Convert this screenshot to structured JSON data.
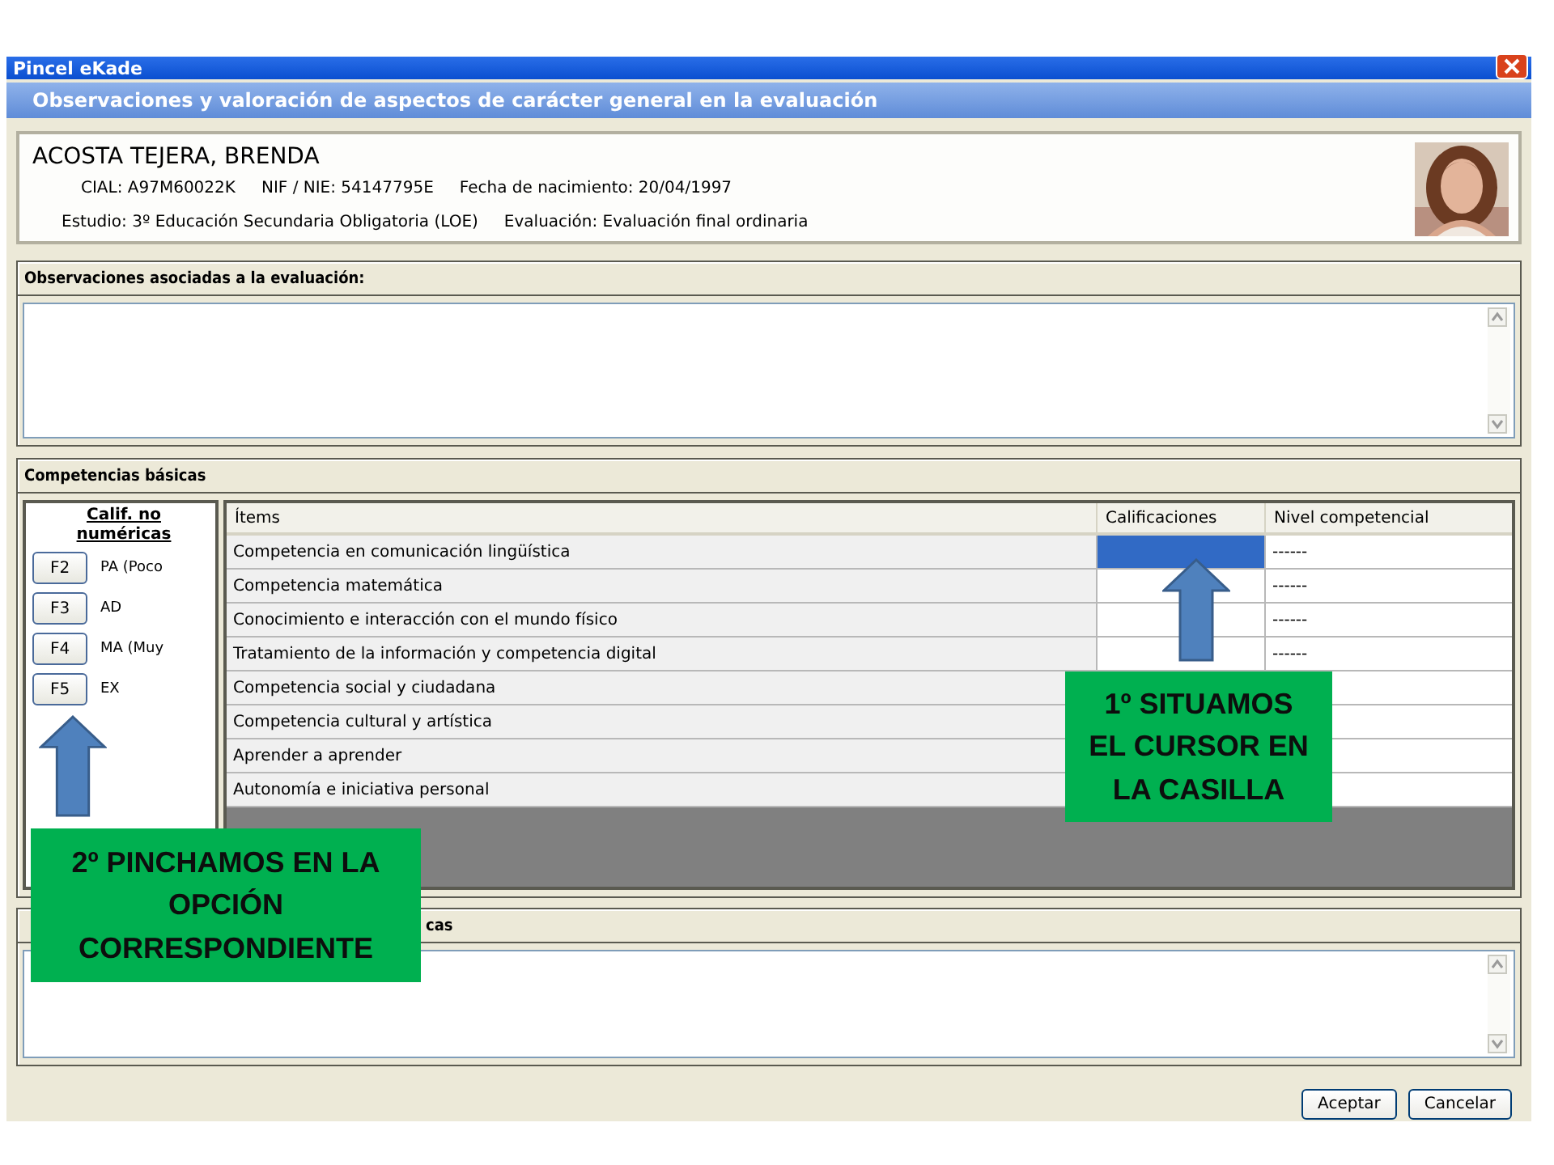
{
  "window": {
    "title": "Pincel eKade"
  },
  "dialog": {
    "title": "Observaciones y valoración de aspectos de carácter general en la evaluación"
  },
  "student": {
    "name": "ACOSTA TEJERA, BRENDA",
    "line_1": [
      "CIAL: A97M60022K",
      "NIF / NIE: 54147795E",
      "Fecha de nacimiento: 20/04/1997"
    ],
    "line_2": [
      "Estudio: 3º Educación Secundaria Obligatoria (LOE)",
      "Evaluación: Evaluación final ordinaria"
    ],
    "photo": {
      "kind": "picture"
    }
  },
  "observations": {
    "heading": "Observaciones asociadas a la evaluación:"
  },
  "competencies": {
    "heading": "Competencias básicas",
    "grades_title": "Calif. no numéricas",
    "grades": [
      {
        "key": "F2",
        "label": "PA (Poco"
      },
      {
        "key": "F3",
        "label": "AD"
      },
      {
        "key": "F4",
        "label": "MA (Muy"
      },
      {
        "key": "F5",
        "label": "EX"
      }
    ],
    "columns": [
      "Ítems",
      "Calificaciones",
      "Nivel competencial"
    ],
    "rows": [
      {
        "item": "Competencia en comunicación lingüística",
        "selected": true,
        "competency_level": "------"
      },
      {
        "item": "Competencia matemática",
        "selected": false,
        "competency_level": "------"
      },
      {
        "item": "Conocimiento e interacción con el mundo físico",
        "selected": false,
        "competency_level": "------"
      },
      {
        "item": "Tratamiento de la información y competencia digital",
        "selected": false,
        "competency_level": "------"
      },
      {
        "item": "Competencia social y ciudadana"
      },
      {
        "item": "Competencia cultural y artística"
      },
      {
        "item": "Aprender a aprender"
      },
      {
        "item": "Autonomía e iniciativa personal"
      }
    ]
  },
  "third_panel": {
    "heading_visible_end": "cas"
  },
  "buttons": [
    "Aceptar",
    "Cancelar"
  ],
  "callouts": [
    {
      "text": "1º SITUAMOS EL CURSOR EN LA CASILLA"
    },
    {
      "text": "2º PINCHAMOS EN LA OPCIÓN CORRESPONDIENTE"
    }
  ]
}
